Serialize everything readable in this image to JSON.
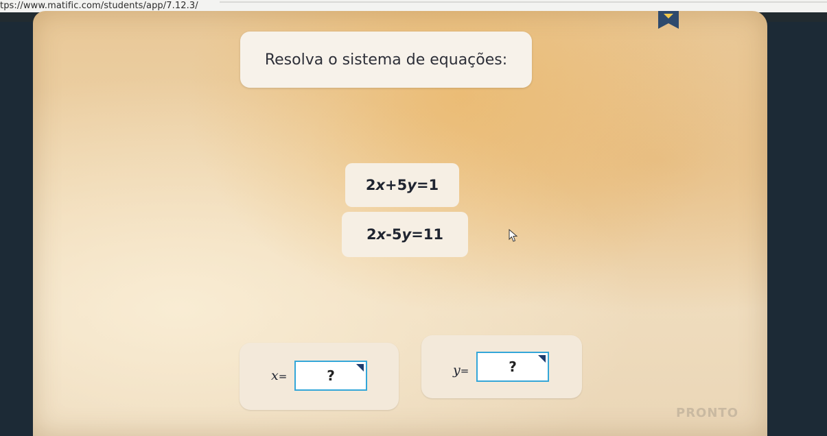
{
  "browser": {
    "url": "tps://www.matific.com/students/app/7.12.3/"
  },
  "activity": {
    "instruction": "Resolva o sistema de equações:",
    "equations": [
      {
        "c1": "2",
        "v1": "x",
        "op": "+",
        "c2": "5",
        "v2": "y",
        "eq": "=",
        "rhs": "1"
      },
      {
        "c1": "2",
        "v1": "x",
        "op": "-",
        "c2": "5",
        "v2": "y",
        "eq": "=",
        "rhs": "11"
      }
    ],
    "answers": {
      "x": {
        "var": "x",
        "eq": "=",
        "placeholder": "?"
      },
      "y": {
        "var": "y",
        "eq": "=",
        "placeholder": "?"
      }
    },
    "submit_label": "PRONTO"
  },
  "icons": {
    "bookmark": "bookmark-ribbon-icon",
    "cursor": "mouse-pointer-icon",
    "input_corner": "input-corner-marker-icon"
  },
  "colors": {
    "input_border": "#33a6d8",
    "submit_disabled": "#c9b9a1"
  }
}
